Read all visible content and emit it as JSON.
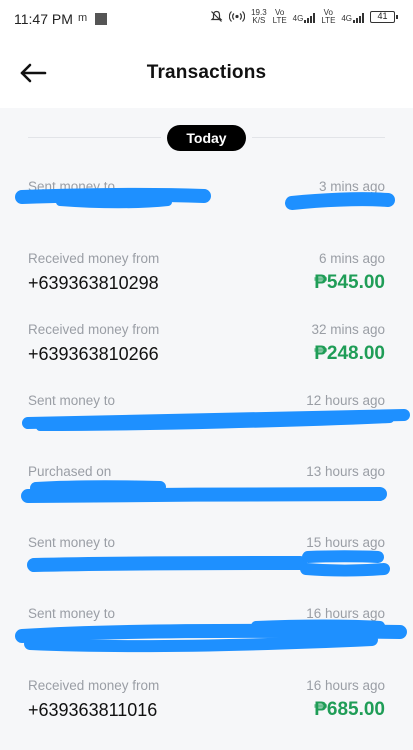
{
  "status_bar": {
    "time": "11:47 PM",
    "indicator": "m",
    "net_speed_top": "19.3",
    "net_speed_bottom": "K/S",
    "volte1": "Vo LTE",
    "net1": "4G",
    "volte2": "Vo LTE",
    "net2": "4G",
    "battery": "41",
    "icons": [
      "notifications-off-icon",
      "hotspot-icon",
      "signal-icon",
      "battery-icon"
    ]
  },
  "header": {
    "title": "Transactions",
    "back_icon": "back-arrow-icon"
  },
  "section": {
    "label": "Today"
  },
  "colors": {
    "amount_green": "#1f9d57",
    "redaction_blue": "#1e90ff",
    "pill_bg": "#000000"
  },
  "transactions": [
    {
      "label": "Sent money to",
      "time": "3 mins ago",
      "number": "",
      "amount": "",
      "redacted": true
    },
    {
      "label": "Received money from",
      "time": "6 mins ago",
      "number": "+639363810298",
      "amount": "₱545.00",
      "redacted": false
    },
    {
      "label": "Received money from",
      "time": "32 mins ago",
      "number": "+639363810266",
      "amount": "₱248.00",
      "redacted": false
    },
    {
      "label": "Sent money to",
      "time": "12 hours ago",
      "number": "",
      "amount": "",
      "redacted": true
    },
    {
      "label": "Purchased on",
      "time": "13 hours ago",
      "number": "",
      "amount": "",
      "redacted": true
    },
    {
      "label": "Sent money to",
      "time": "15 hours ago",
      "number": "",
      "amount": "",
      "redacted": true
    },
    {
      "label": "Sent money to",
      "time": "16 hours ago",
      "number": "",
      "amount": "",
      "redacted": true
    },
    {
      "label": "Received money from",
      "time": "16 hours ago",
      "number": "+639363811016",
      "amount": "₱685.00",
      "redacted": false
    }
  ]
}
